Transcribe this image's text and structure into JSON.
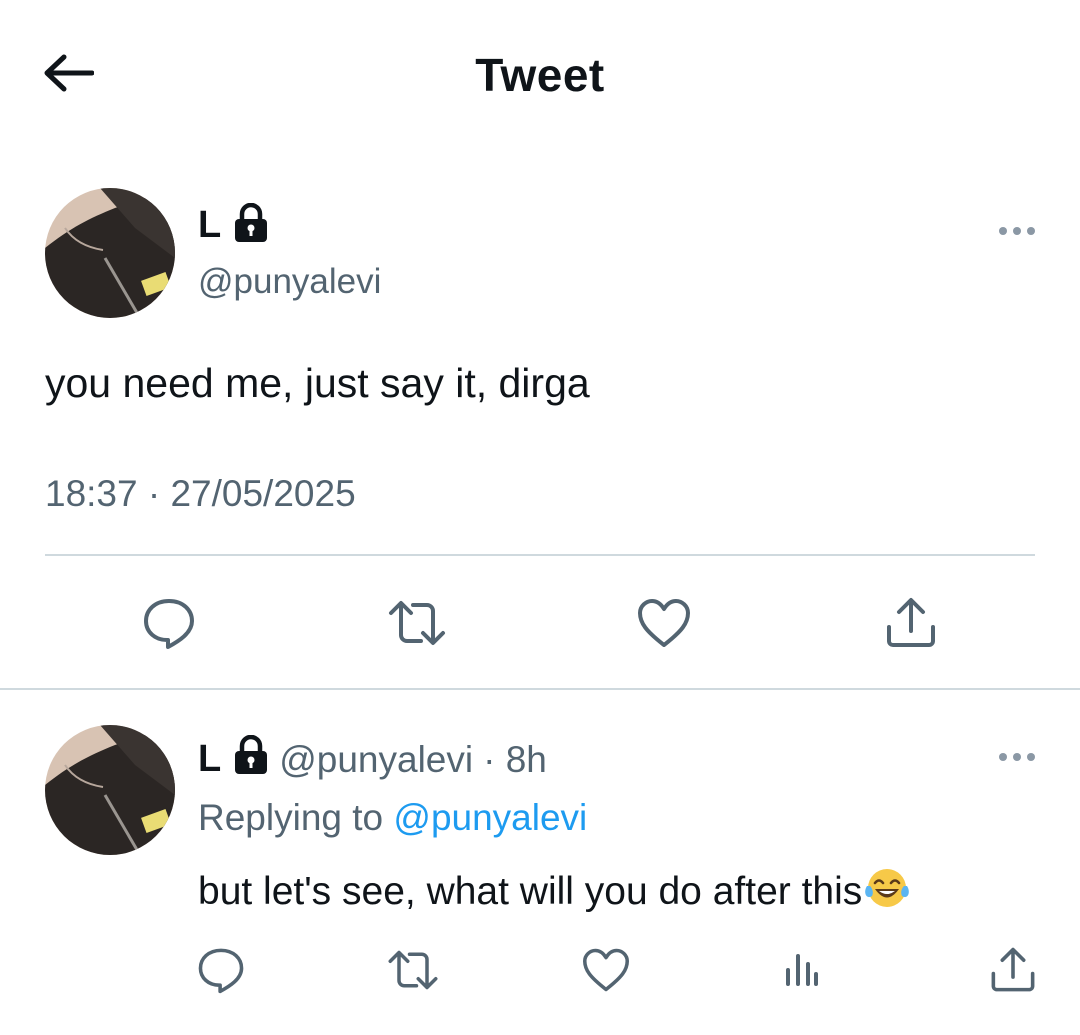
{
  "header": {
    "title": "Tweet"
  },
  "main_tweet": {
    "display_name": "L",
    "handle": "@punyalevi",
    "text": "you need me, just say it, dirga",
    "timestamp": "18:37 · 27/05/2025"
  },
  "reply": {
    "display_name": "L",
    "handle": "@punyalevi",
    "age": "· 8h",
    "replying_prefix": "Replying to",
    "replying_mention": "@punyalevi",
    "text": "but let's see, what will you do after this",
    "emoji": "face-with-tears-of-joy"
  },
  "colors": {
    "text": "#0f1419",
    "secondary": "#536471",
    "link": "#1d9bf0",
    "divider": "#cfd9de"
  }
}
